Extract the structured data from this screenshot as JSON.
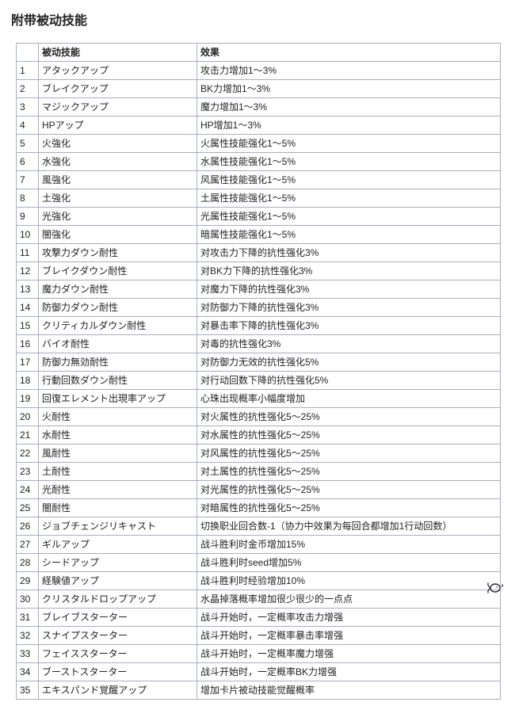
{
  "heading": "附带被动技能",
  "columns": {
    "skill": "被动技能",
    "effect": "效果"
  },
  "rows": [
    {
      "n": "1",
      "skill": "アタックアップ",
      "effect": "攻击力增加1～3%"
    },
    {
      "n": "2",
      "skill": "ブレイクアップ",
      "effect": "BK力增加1～3%"
    },
    {
      "n": "3",
      "skill": "マジックアップ",
      "effect": "魔力增加1～3%"
    },
    {
      "n": "4",
      "skill": "HPアップ",
      "effect": "HP增加1～3%"
    },
    {
      "n": "5",
      "skill": "火強化",
      "effect": "火属性技能强化1～5%"
    },
    {
      "n": "6",
      "skill": "水強化",
      "effect": "水属性技能强化1～5%"
    },
    {
      "n": "7",
      "skill": "風強化",
      "effect": "风属性技能强化1～5%"
    },
    {
      "n": "8",
      "skill": "土強化",
      "effect": "土属性技能强化1～5%"
    },
    {
      "n": "9",
      "skill": "光強化",
      "effect": "光属性技能强化1～5%"
    },
    {
      "n": "10",
      "skill": "闇強化",
      "effect": "暗属性技能强化1～5%"
    },
    {
      "n": "11",
      "skill": "攻撃力ダウン耐性",
      "effect": "对攻击力下降的抗性强化3%"
    },
    {
      "n": "12",
      "skill": "ブレイクダウン耐性",
      "effect": "对BK力下降的抗性强化3%"
    },
    {
      "n": "13",
      "skill": "魔力ダウン耐性",
      "effect": "对魔力下降的抗性强化3%"
    },
    {
      "n": "14",
      "skill": "防御力ダウン耐性",
      "effect": "对防御力下降的抗性强化3%"
    },
    {
      "n": "15",
      "skill": "クリティカルダウン耐性",
      "effect": "对暴击率下降的抗性强化3%"
    },
    {
      "n": "16",
      "skill": "バイオ耐性",
      "effect": "对毒的抗性强化3%"
    },
    {
      "n": "17",
      "skill": "防御力無効耐性",
      "effect": "对防御力无效的抗性强化5%"
    },
    {
      "n": "18",
      "skill": "行動回数ダウン耐性",
      "effect": "对行动回数下降的抗性强化5%"
    },
    {
      "n": "19",
      "skill": "回復エレメント出現率アップ",
      "effect": "心珠出现概率小幅度增加"
    },
    {
      "n": "20",
      "skill": "火耐性",
      "effect": "对火属性的抗性强化5～25%"
    },
    {
      "n": "21",
      "skill": "水耐性",
      "effect": "对水属性的抗性强化5～25%"
    },
    {
      "n": "22",
      "skill": "風耐性",
      "effect": "对风属性的抗性强化5～25%"
    },
    {
      "n": "23",
      "skill": "土耐性",
      "effect": "对土属性的抗性强化5～25%"
    },
    {
      "n": "24",
      "skill": "光耐性",
      "effect": "对光属性的抗性强化5～25%"
    },
    {
      "n": "25",
      "skill": "闇耐性",
      "effect": "对暗属性的抗性强化5～25%"
    },
    {
      "n": "26",
      "skill": "ジョブチェンジリキャスト",
      "effect": "切换职业回合数-1（协力中效果为每回合都增加1行动回数）"
    },
    {
      "n": "27",
      "skill": "ギルアップ",
      "effect": "战斗胜利时金币增加15%"
    },
    {
      "n": "28",
      "skill": "シードアップ",
      "effect": "战斗胜利时seed增加5%"
    },
    {
      "n": "29",
      "skill": "経験値アップ",
      "effect": "战斗胜利时经验增加10%"
    },
    {
      "n": "30",
      "skill": "クリスタルドロップアップ",
      "effect": "水晶掉落概率增加很少很少的一点点"
    },
    {
      "n": "31",
      "skill": "ブレイブスターター",
      "effect": "战斗开始时，一定概率攻击力增强"
    },
    {
      "n": "32",
      "skill": "スナイプスターター",
      "effect": "战斗开始时，一定概率暴击率增强"
    },
    {
      "n": "33",
      "skill": "フェイススターター",
      "effect": "战斗开始时，一定概率魔力增强"
    },
    {
      "n": "34",
      "skill": "ブーストスターター",
      "effect": "战斗开始时，一定概率BK力增强"
    },
    {
      "n": "35",
      "skill": "エキスパンド覚醒アップ",
      "effect": "增加卡片被动技能觉醒概率"
    }
  ]
}
